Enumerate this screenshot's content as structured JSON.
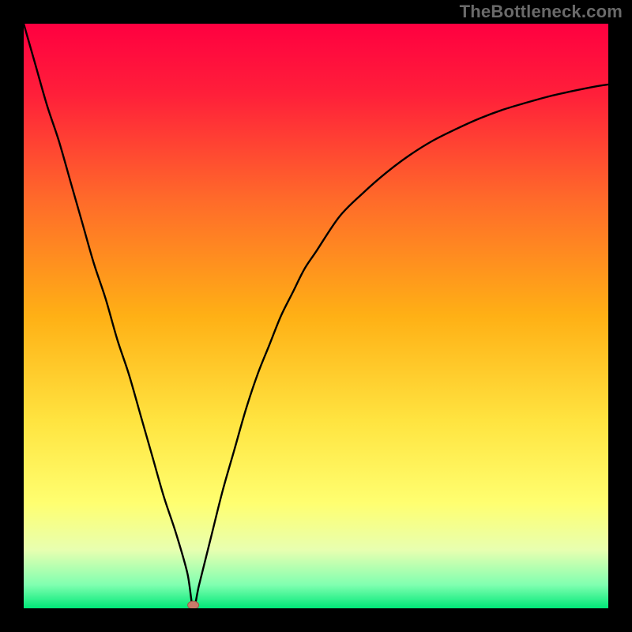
{
  "watermark": "TheBottleneck.com",
  "colors": {
    "gradient_stops": [
      {
        "offset": "0%",
        "color": "#ff0040"
      },
      {
        "offset": "12%",
        "color": "#ff1f3a"
      },
      {
        "offset": "30%",
        "color": "#ff6a2a"
      },
      {
        "offset": "50%",
        "color": "#ffb015"
      },
      {
        "offset": "68%",
        "color": "#ffe440"
      },
      {
        "offset": "82%",
        "color": "#ffff70"
      },
      {
        "offset": "90%",
        "color": "#e8ffb0"
      },
      {
        "offset": "96%",
        "color": "#80ffb0"
      },
      {
        "offset": "100%",
        "color": "#00e878"
      }
    ],
    "curve_stroke": "#000000",
    "marker_fill": "#c97a6a",
    "marker_stroke": "#9a5a4a",
    "frame": "#000000"
  },
  "chart_data": {
    "type": "line",
    "title": "",
    "xlabel": "",
    "ylabel": "",
    "xlim": [
      0,
      100
    ],
    "ylim": [
      0,
      100
    ],
    "min_point": {
      "x": 29,
      "y": 0
    },
    "series": [
      {
        "name": "bottleneck-curve",
        "x": [
          0,
          2,
          4,
          6,
          8,
          10,
          12,
          14,
          16,
          18,
          20,
          22,
          24,
          26,
          28,
          29,
          30,
          32,
          34,
          36,
          38,
          40,
          42,
          44,
          46,
          48,
          50,
          54,
          58,
          62,
          66,
          70,
          74,
          78,
          82,
          86,
          90,
          94,
          98,
          100
        ],
        "y": [
          100,
          93,
          86,
          80,
          73,
          66,
          59,
          53,
          46,
          40,
          33,
          26,
          19,
          13,
          6,
          0,
          4,
          12,
          20,
          27,
          34,
          40,
          45,
          50,
          54,
          58,
          61,
          67,
          71,
          74.5,
          77.5,
          80,
          82,
          83.8,
          85.3,
          86.5,
          87.6,
          88.5,
          89.3,
          89.6
        ]
      }
    ]
  }
}
